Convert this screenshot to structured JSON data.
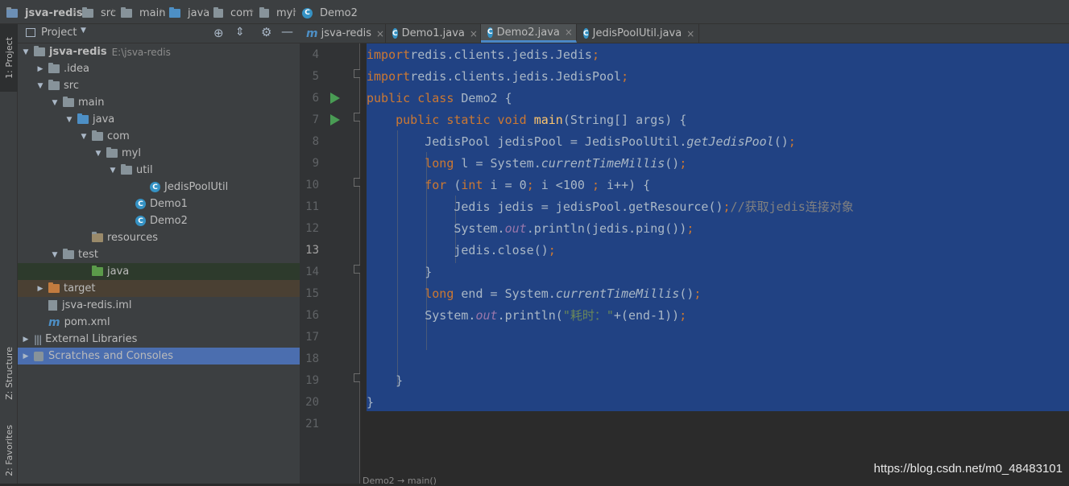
{
  "breadcrumb": [
    {
      "label": "jsva-redis",
      "icon": "project-module-icon"
    },
    {
      "label": "src",
      "icon": "folder-icon"
    },
    {
      "label": "main",
      "icon": "folder-icon"
    },
    {
      "label": "java",
      "icon": "source-folder-icon"
    },
    {
      "label": "com",
      "icon": "package-icon"
    },
    {
      "label": "myl",
      "icon": "package-icon"
    },
    {
      "label": "Demo2",
      "icon": "class-icon"
    }
  ],
  "tool_stripe": {
    "project": "1: Project",
    "structure": "Z: Structure",
    "favorites": "2: Favorites"
  },
  "project_panel": {
    "title": "Project",
    "tree": [
      {
        "label": "jsva-redis",
        "hint": "E:\\jsva-redis",
        "arrow": "▼",
        "icon": "module"
      },
      {
        "label": ".idea",
        "arrow": "▶",
        "icon": "folder"
      },
      {
        "label": "src",
        "arrow": "▼",
        "icon": "folder"
      },
      {
        "label": "main",
        "arrow": "▼",
        "icon": "folder"
      },
      {
        "label": "java",
        "arrow": "▼",
        "icon": "folder-blue"
      },
      {
        "label": "com",
        "arrow": "▼",
        "icon": "package"
      },
      {
        "label": "myl",
        "arrow": "▼",
        "icon": "package"
      },
      {
        "label": "util",
        "arrow": "▼",
        "icon": "package"
      },
      {
        "label": "JedisPoolUtil",
        "arrow": "",
        "icon": "class"
      },
      {
        "label": "Demo1",
        "arrow": "",
        "icon": "class-run"
      },
      {
        "label": "Demo2",
        "arrow": "",
        "icon": "class-run"
      },
      {
        "label": "resources",
        "arrow": "",
        "icon": "folder-resources"
      },
      {
        "label": "test",
        "arrow": "▼",
        "icon": "folder"
      },
      {
        "label": "java",
        "arrow": "",
        "icon": "folder-green"
      },
      {
        "label": "target",
        "arrow": "▶",
        "icon": "folder-orange"
      },
      {
        "label": "jsva-redis.iml",
        "arrow": "",
        "icon": "iml-file"
      },
      {
        "label": "pom.xml",
        "arrow": "",
        "icon": "maven-file"
      },
      {
        "label": "External Libraries",
        "arrow": "▶",
        "icon": "libraries"
      },
      {
        "label": "Scratches and Consoles",
        "arrow": "▶",
        "icon": "scratches"
      }
    ]
  },
  "editor_tabs": [
    {
      "label": "jsva-redis",
      "icon": "maven-m-icon",
      "active": false
    },
    {
      "label": "Demo1.java",
      "icon": "class-icon",
      "active": false
    },
    {
      "label": "Demo2.java",
      "icon": "class-icon",
      "active": true
    },
    {
      "label": "JedisPoolUtil.java",
      "icon": "class-icon",
      "active": false
    }
  ],
  "editor": {
    "current_line": "13",
    "lines": [
      {
        "n": "4",
        "code": [
          [
            "kw",
            "import"
          ],
          [
            "",
            "redis.clients.jedis.Jedis"
          ],
          [
            "kw",
            ";"
          ]
        ]
      },
      {
        "n": "5",
        "code": [
          [
            "kw",
            "import"
          ],
          [
            "",
            "redis.clients.jedis.JedisPool"
          ],
          [
            "kw",
            ";"
          ]
        ]
      },
      {
        "n": "6",
        "code": [
          [
            "kw",
            "public class "
          ],
          [
            "",
            "Demo2 {"
          ]
        ]
      },
      {
        "n": "7",
        "code": [
          [
            "",
            "    "
          ],
          [
            "kw",
            "public static void "
          ],
          [
            "fn",
            "main"
          ],
          [
            "",
            "(String[] args) {"
          ]
        ]
      },
      {
        "n": "8",
        "code": [
          [
            "",
            "        JedisPool jedisPool = JedisPoolUtil."
          ],
          [
            "sm",
            "getJedisPool"
          ],
          [
            "",
            "()"
          ],
          [
            "kw",
            ";"
          ]
        ]
      },
      {
        "n": "9",
        "code": [
          [
            "",
            "        "
          ],
          [
            "kw",
            "long "
          ],
          [
            "",
            "l = System."
          ],
          [
            "sm",
            "currentTimeMillis"
          ],
          [
            "",
            "()"
          ],
          [
            "kw",
            ";"
          ]
        ]
      },
      {
        "n": "10",
        "code": [
          [
            "",
            "        "
          ],
          [
            "kw",
            "for "
          ],
          [
            "",
            "("
          ],
          [
            "kw",
            "int "
          ],
          [
            "",
            "i = "
          ],
          [
            "",
            "0"
          ],
          [
            "kw",
            "; "
          ],
          [
            "",
            "i <"
          ],
          [
            "",
            "100 "
          ],
          [
            "kw",
            "; "
          ],
          [
            "",
            "i++) {"
          ]
        ]
      },
      {
        "n": "11",
        "code": [
          [
            "",
            "            Jedis jedis = jedisPool.getResource()"
          ],
          [
            "kw",
            ";"
          ],
          [
            "cm",
            "//获取jedis连接对象"
          ]
        ]
      },
      {
        "n": "12",
        "code": [
          [
            "",
            "            System."
          ],
          [
            "st",
            "out"
          ],
          [
            "",
            ".println(jedis.ping())"
          ],
          [
            "kw",
            ";"
          ]
        ]
      },
      {
        "n": "13",
        "code": [
          [
            "",
            "            jedis.close()"
          ],
          [
            "kw",
            ";"
          ]
        ]
      },
      {
        "n": "14",
        "code": [
          [
            "",
            "        }"
          ]
        ]
      },
      {
        "n": "15",
        "code": [
          [
            "",
            "        "
          ],
          [
            "kw",
            "long "
          ],
          [
            "",
            "end = System."
          ],
          [
            "sm",
            "currentTimeMillis"
          ],
          [
            "",
            "()"
          ],
          [
            "kw",
            ";"
          ]
        ]
      },
      {
        "n": "16",
        "code": [
          [
            "",
            "        System."
          ],
          [
            "st",
            "out"
          ],
          [
            "",
            ".println("
          ],
          [
            "str",
            "\"耗时：\""
          ],
          [
            "",
            "+(end-1))"
          ],
          [
            "kw",
            ";"
          ]
        ]
      },
      {
        "n": "17",
        "code": []
      },
      {
        "n": "18",
        "code": []
      },
      {
        "n": "19",
        "code": [
          [
            "",
            "    }"
          ]
        ]
      },
      {
        "n": "20",
        "code": [
          [
            "",
            "}"
          ]
        ]
      },
      {
        "n": "21",
        "code": []
      }
    ]
  },
  "watermark": "https://blog.csdn.net/m0_48483101",
  "status_stub": "Demo2 → main()",
  "colors": {
    "selection": "#214283",
    "keyword": "#cc7832",
    "function": "#ffc66d",
    "static_field": "#9876aa",
    "string": "#6a8759",
    "comment": "#808080",
    "run_icon": "#499c54",
    "panel_selection": "#4b6eaf"
  }
}
